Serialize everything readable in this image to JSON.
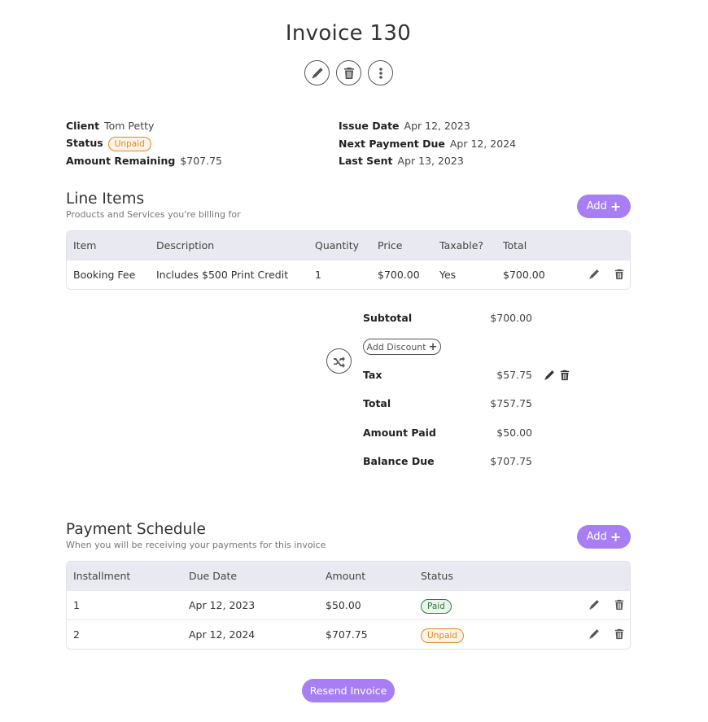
{
  "header": {
    "title": "Invoice 130"
  },
  "header_actions": [
    {
      "name": "edit",
      "icon": "pencil-icon"
    },
    {
      "name": "delete",
      "icon": "trash-icon"
    },
    {
      "name": "more",
      "icon": "more-vertical-icon"
    }
  ],
  "details": {
    "client_label": "Client",
    "client_value": "Tom Petty",
    "status_label": "Status",
    "status_value": "Unpaid",
    "remaining_label": "Amount Remaining",
    "remaining_value": "$707.75",
    "issue_label": "Issue Date",
    "issue_value": "Apr 12, 2023",
    "next_label": "Next Payment Due",
    "next_value": "Apr 12, 2024",
    "sent_label": "Last Sent",
    "sent_value": "Apr 13, 2023"
  },
  "line_items": {
    "title": "Line Items",
    "subtitle": "Products and Services you're billing for",
    "add_label": "Add",
    "columns": [
      "Item",
      "Description",
      "Quantity",
      "Price",
      "Taxable?",
      "Total"
    ],
    "rows": [
      {
        "item": "Booking Fee",
        "description": "Includes $500 Print Credit",
        "quantity": "1",
        "price": "$700.00",
        "taxable": "Yes",
        "total": "$700.00"
      }
    ]
  },
  "summary": {
    "subtotal_label": "Subtotal",
    "subtotal_value": "$700.00",
    "discount_label": "Add Discount",
    "tax_label": "Tax",
    "tax_value": "$57.75",
    "total_label": "Total",
    "total_value": "$757.75",
    "paid_label": "Amount Paid",
    "paid_value": "$50.00",
    "balance_label": "Balance Due",
    "balance_value": "$707.75"
  },
  "payment_schedule": {
    "title": "Payment Schedule",
    "subtitle": "When you will be receiving your payments for this invoice",
    "add_label": "Add",
    "columns": [
      "Installment",
      "Due Date",
      "Amount",
      "Status"
    ],
    "rows": [
      {
        "installment": "1",
        "due_date": "Apr 12, 2023",
        "amount": "$50.00",
        "status": "Paid"
      },
      {
        "installment": "2",
        "due_date": "Apr 12, 2024",
        "amount": "$707.75",
        "status": "Unpaid"
      }
    ]
  },
  "footer": {
    "resend_label": "Resend Invoice"
  },
  "colors": {
    "accent": "#a77ff3",
    "unpaid": "#e08a1e",
    "paid": "#2e7d3a",
    "table_header": "#e9e9f1"
  }
}
